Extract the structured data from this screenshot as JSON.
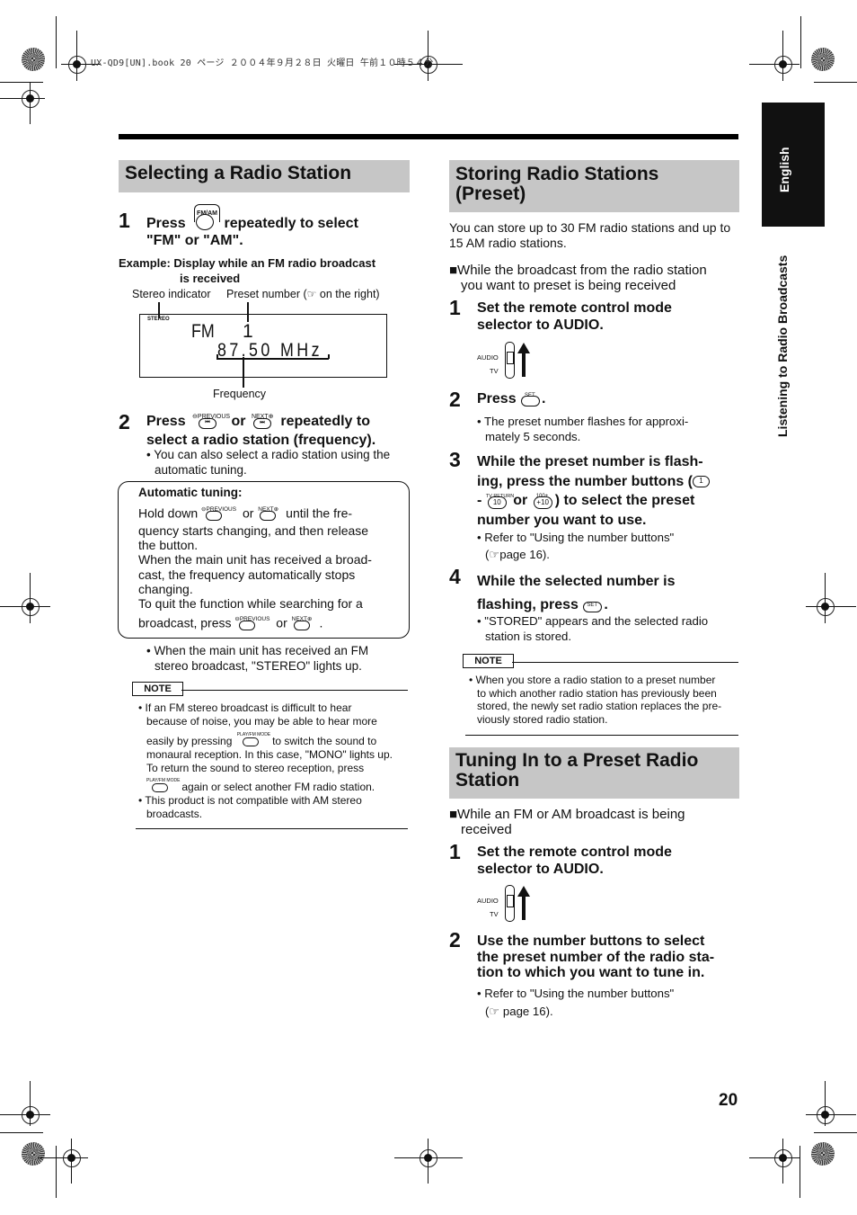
{
  "header": {
    "print_info": "UX-QD9[UN].book  20 ページ  ２００４年９月２８日  火曜日  午前１０時５４分"
  },
  "sidebar": {
    "language_tab": "English",
    "chapter_label": "Listening to Radio Broadcasts"
  },
  "page_number": "20",
  "left": {
    "title": "Selecting a Radio Station",
    "step1": {
      "num": "1",
      "text_before": "Press",
      "button_label": "FM/AM",
      "text_after": "repeatedly to select",
      "line2": "\"FM\" or \"AM\"."
    },
    "example": {
      "line1": "Example: Display while an FM radio broadcast",
      "line2": "is received",
      "label_stereo": "Stereo indicator",
      "label_preset_before": "Preset number (",
      "label_preset_after": "on the right)",
      "label_frequency": "Frequency",
      "lcd_stereo": "STEREO",
      "lcd_band": "FM",
      "lcd_preset": "1",
      "lcd_frequency": "87.50 MHz"
    },
    "step2": {
      "num": "2",
      "text_press": "Press",
      "prev_label": "PREVIOUS",
      "or": "or",
      "next_label": "NEXT",
      "text_after": "repeatedly to",
      "line2": "select a radio station (frequency).",
      "bullet1": "You can also select a radio station using the",
      "bullet1b": "automatic tuning."
    },
    "auto_tuning": {
      "title": "Automatic tuning:",
      "hold_down": "Hold down",
      "or": "or",
      "until": "until the fre-",
      "l2": "quency starts changing, and then release",
      "l3": "the button.",
      "l4": "When the main unit has received a broad-",
      "l5": "cast, the frequency automatically stops",
      "l6": "changing.",
      "l7": "To quit the function while searching for a",
      "l8": "broadcast, press",
      "l8_end": "."
    },
    "stereo_bullet": {
      "l1": "When the main unit has received an FM",
      "l2": "stereo broadcast, \"STEREO\" lights up."
    },
    "note": {
      "label": "NOTE",
      "b1_l1": "If an FM stereo broadcast is difficult to hear",
      "b1_l2": "because of noise, you may be able to hear more",
      "b1_l3a": "easily by pressing",
      "b1_l3b": "to switch the sound to",
      "b1_l4": "monaural reception. In this case, \"MONO\" lights up.",
      "b1_l5": "To return the sound to stereo reception, press",
      "b1_l6": "again or select another FM radio station.",
      "b2_l1": "This product is not compatible with AM stereo",
      "b2_l2": "broadcasts.",
      "button_label": "PLAY/FM MODE"
    }
  },
  "right": {
    "storing": {
      "title_l1": "Storing Radio Stations",
      "title_l2": "(Preset)",
      "intro_l1": "You can store up to 30 FM radio stations and up to",
      "intro_l2": "15 AM radio stations.",
      "cond_l1": "■While the broadcast from the radio station",
      "cond_l2": "you want to preset is being received",
      "step1": {
        "num": "1",
        "l1": "Set the remote control mode",
        "l2": "selector to AUDIO."
      },
      "mode_selector": {
        "audio": "AUDIO",
        "tv": "TV"
      },
      "step2": {
        "num": "2",
        "text": "Press",
        "button_label": "SET",
        "end": ".",
        "bullet_l1": "The preset number flashes for approxi-",
        "bullet_l2": "mately 5 seconds."
      },
      "step3": {
        "num": "3",
        "l1": "While the preset number is flash-",
        "l2": "ing, press the number buttons (",
        "btn1": "1",
        "l3_dash": "-",
        "btn10": "10",
        "btn10_tag": "TV RETURN",
        "or": "or",
        "btn_plus10": "+10",
        "btn_plus10_tag": "100+",
        "l3_end": ") to select the preset",
        "l4": "number you want to use.",
        "bullet_l1": "Refer to \"Using the number buttons\"",
        "bullet_l2": "page 16)."
      },
      "step4": {
        "num": "4",
        "l1": "While the selected number is",
        "l2": "flashing, press",
        "button_label": "SET",
        "end": ".",
        "bullet_l1": "\"STORED\" appears and the selected radio",
        "bullet_l2": "station is stored."
      },
      "note": {
        "label": "NOTE",
        "l1": "When you store a radio station to a preset number",
        "l2": "to which another radio station has previously been",
        "l3": "stored, the newly set radio station replaces the pre-",
        "l4": "viously stored radio station."
      }
    },
    "tuning": {
      "title_l1": "Tuning In to a Preset Radio",
      "title_l2": "Station",
      "cond_l1": "■While an FM or AM broadcast is being",
      "cond_l2": "received",
      "step1": {
        "num": "1",
        "l1": "Set the remote control mode",
        "l2": "selector to AUDIO."
      },
      "mode_selector": {
        "audio": "AUDIO",
        "tv": "TV"
      },
      "step2": {
        "num": "2",
        "l1": "Use the number buttons to select",
        "l2": "the preset number of the radio sta-",
        "l3": "tion to which you want to tune in.",
        "bullet_l1": "Refer to \"Using the number buttons\"",
        "bullet_l2": "page 16)."
      }
    }
  }
}
